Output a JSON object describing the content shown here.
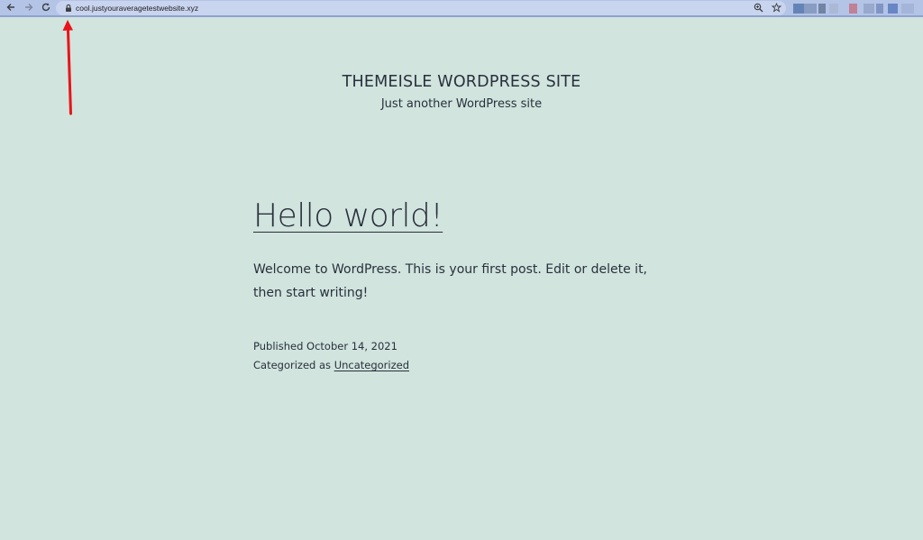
{
  "browser": {
    "url": "cool.justyouraveragetestwebsite.xyz",
    "back_icon": "arrow-left",
    "forward_icon": "arrow-right",
    "reload_icon": "reload",
    "zoom_icon": "magnifier",
    "bookmark_icon": "star",
    "extension_colors": [
      "#4a6fa5",
      "#7b8fb5",
      "#5d6d8e",
      "#a8b4d0",
      "#c46a7a",
      "#8fa0c4",
      "#6f86b8",
      "#4f72b8",
      "#9fb0d4"
    ]
  },
  "site": {
    "title": "THEMEISLE WORDPRESS SITE",
    "description": "Just another WordPress site"
  },
  "post": {
    "title": "Hello world!",
    "content": "Welcome to WordPress. This is your first post. Edit or delete it, then start writing!",
    "published_label": "Published",
    "published_date": "October 14, 2021",
    "categorized_label": "Categorized as",
    "category": "Uncategorized"
  },
  "annotation": {
    "arrow_color": "#e8141a"
  }
}
